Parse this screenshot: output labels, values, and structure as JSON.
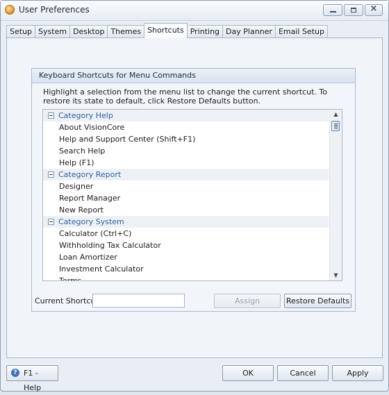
{
  "window": {
    "title": "User Preferences"
  },
  "tabs": [
    {
      "label": "Setup"
    },
    {
      "label": "System"
    },
    {
      "label": "Desktop"
    },
    {
      "label": "Themes"
    },
    {
      "label": "Shortcuts",
      "active": true
    },
    {
      "label": "Printing"
    },
    {
      "label": "Day Planner"
    },
    {
      "label": "Email Setup"
    }
  ],
  "shortcuts": {
    "group_title": "Keyboard Shortcuts for Menu Commands",
    "instructions": "Highlight a selection from the menu list to change the current shortcut. To restore its state to default, click Restore Defaults button.",
    "tree": [
      {
        "type": "category",
        "label": "Category Help"
      },
      {
        "type": "item",
        "label": "About VisionCore"
      },
      {
        "type": "item",
        "label": "Help and Support Center (Shift+F1)"
      },
      {
        "type": "item",
        "label": "Search Help"
      },
      {
        "type": "item",
        "label": "Help (F1)"
      },
      {
        "type": "category",
        "label": "Category Report"
      },
      {
        "type": "item",
        "label": "Designer"
      },
      {
        "type": "item",
        "label": "Report Manager"
      },
      {
        "type": "item",
        "label": "New Report"
      },
      {
        "type": "category",
        "label": "Category System"
      },
      {
        "type": "item",
        "label": "Calculator (Ctrl+C)"
      },
      {
        "type": "item",
        "label": "Withholding Tax Calculator"
      },
      {
        "type": "item",
        "label": "Loan Amortizer"
      },
      {
        "type": "item",
        "label": "Investment Calculator"
      },
      {
        "type": "item",
        "label": "Terms",
        "partial": true
      }
    ],
    "current_shortcut_label": "Current Shortcut",
    "current_shortcut_value": "",
    "assign_label": "Assign",
    "restore_label": "Restore Defaults"
  },
  "footer": {
    "help_label": "F1 - Help",
    "ok_label": "OK",
    "cancel_label": "Cancel",
    "apply_label": "Apply"
  },
  "icons": {
    "app": "preferences-app-icon",
    "help": "help-icon",
    "expander": "collapse-minus-icon"
  },
  "colors": {
    "category_text": "#2f5f9a",
    "category_row_bg": "#edf1f6"
  }
}
